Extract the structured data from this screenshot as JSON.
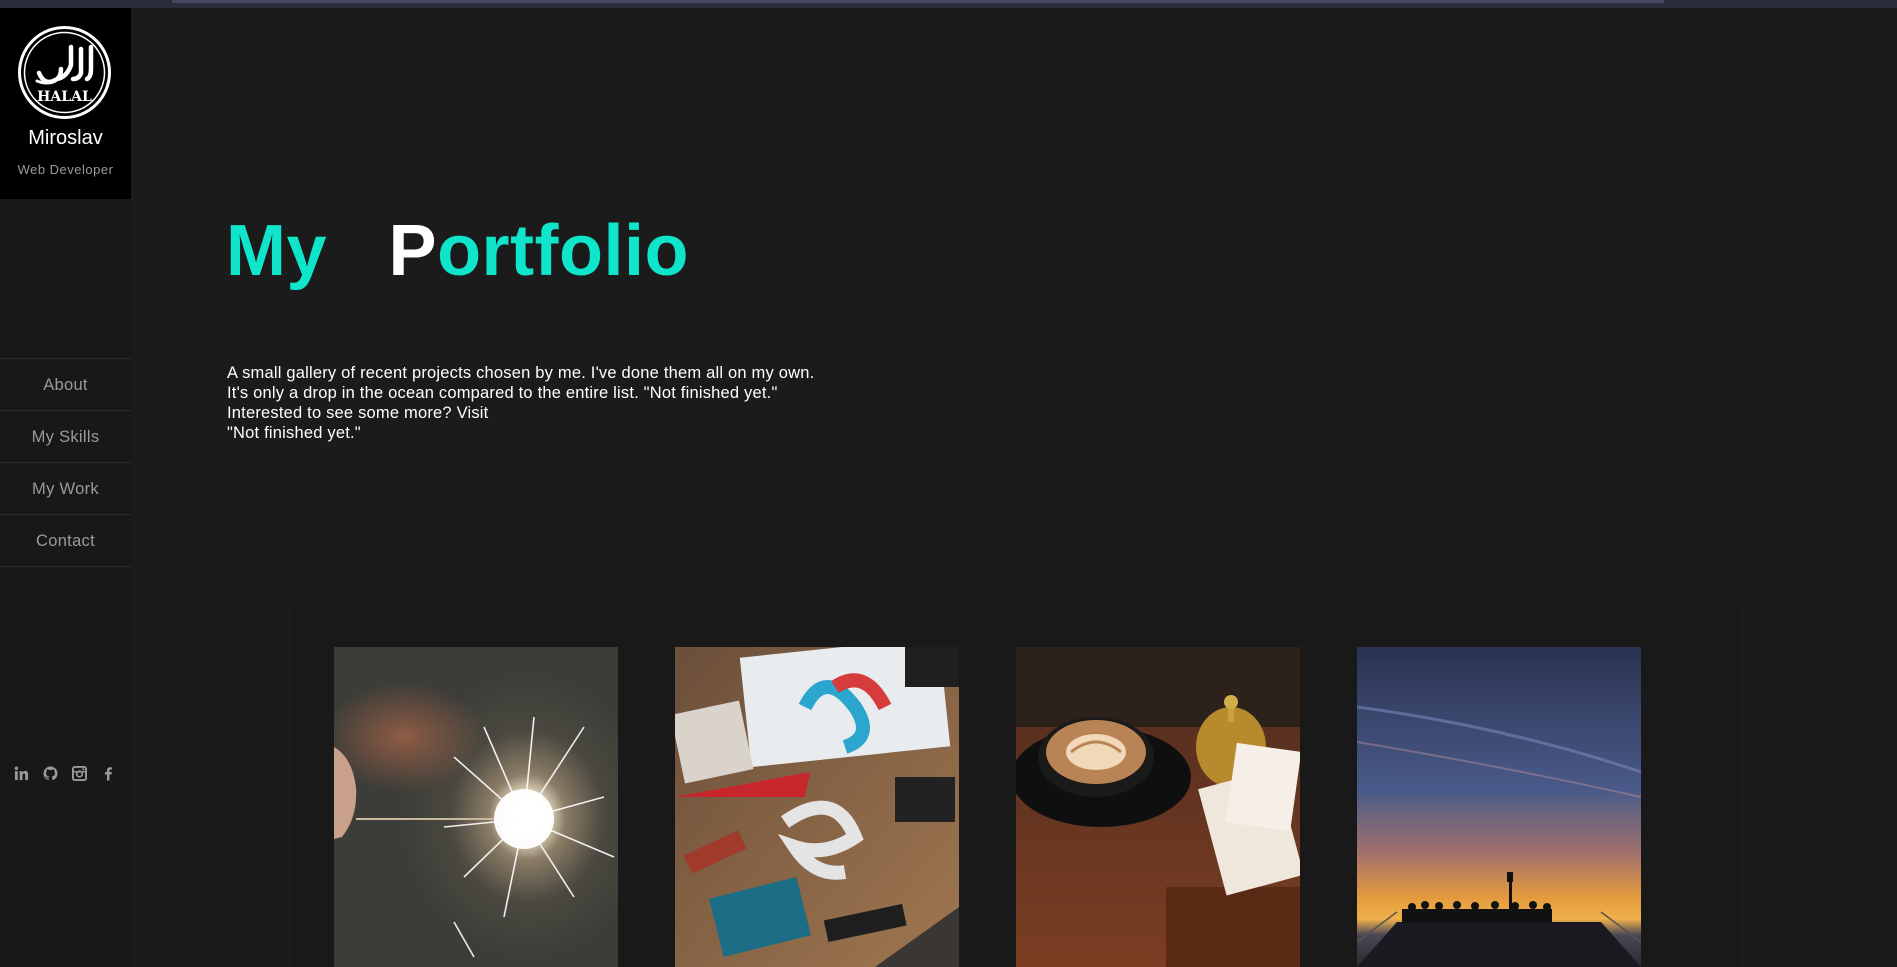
{
  "brand": {
    "logo_text": "HALAL",
    "name": "Miroslav",
    "role": "Web Developer"
  },
  "nav": {
    "items": [
      {
        "label": "About"
      },
      {
        "label": "My Skills"
      },
      {
        "label": "My Work"
      },
      {
        "label": "Contact"
      }
    ]
  },
  "social": [
    "linkedin-icon",
    "github-icon",
    "instagram-icon",
    "facebook-icon"
  ],
  "hero": {
    "title_part1": "My",
    "title_initial": "P",
    "title_rest": "ortfolio"
  },
  "intro": {
    "lines": [
      "A small gallery of recent projects chosen by me. I've done them all on my own.",
      "It's only a drop in the ocean compared to the entire list. \"Not finished yet.\"",
      "Interested to see some more? Visit",
      "\"Not finished yet.\""
    ]
  },
  "gallery": {
    "items": [
      {
        "subject": "sparkler"
      },
      {
        "subject": "back to school flatlay"
      },
      {
        "subject": "latte coffee"
      },
      {
        "subject": "pier sunset"
      }
    ]
  },
  "colors": {
    "accent": "#0fe5cb",
    "background": "#1b1b1b",
    "sidebar": "#181818"
  }
}
